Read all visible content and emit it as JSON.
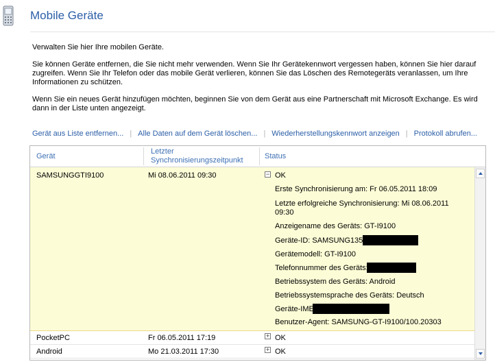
{
  "page": {
    "title": "Mobile Geräte"
  },
  "intro": {
    "line1": "Verwalten Sie hier Ihre mobilen Geräte.",
    "para2": "Sie können Geräte entfernen, die Sie nicht mehr verwenden. Wenn Sie Ihr Gerätekennwort vergessen haben, können Sie hier darauf zugreifen. Wenn Sie Ihr Telefon oder das mobile Gerät verlieren, können Sie das Löschen des Remotegeräts veranlassen, um Ihre Informationen zu schützen.",
    "para3": "Wenn Sie ein neues Gerät hinzufügen möchten, beginnen Sie von dem Gerät aus eine Partnerschaft mit Microsoft Exchange. Es wird dann in der Liste unten angezeigt."
  },
  "actions": [
    "Gerät aus Liste entfernen...",
    "Alle Daten auf dem Gerät löschen...",
    "Wiederherstellungskennwort anzeigen",
    "Protokoll abrufen..."
  ],
  "table": {
    "columns": [
      "Gerät",
      "Letzter Synchronisierungszeitpunkt",
      "Status"
    ],
    "rows": [
      {
        "device": "SAMSUNGGTI9100",
        "last_sync": "Mi 08.06.2011 09:30",
        "status": "OK",
        "toggle": "−"
      },
      {
        "device": "PocketPC",
        "last_sync": "Fr 06.05.2011 17:19",
        "status": "OK",
        "toggle": "+"
      },
      {
        "device": "Android",
        "last_sync": "Mo 21.03.2011 17:30",
        "status": "OK",
        "toggle": "+"
      }
    ],
    "details": [
      "Erste Synchronisierung am: Fr 06.05.2011 18:09",
      "Letzte erfolgreiche Synchronisierung: Mi 08.06.2011",
      "09:30",
      "Anzeigename des Geräts: GT-I9100",
      "Geräte-ID: SAMSUNG1355",
      "Gerätemodell: GT-I9100",
      "Telefonnummer des Geräts:",
      "Betriebssystem des Geräts: Android",
      "Betriebssystemsprache des Geräts: Deutsch",
      "Geräte-IMEI: 355",
      "Benutzer-Agent: SAMSUNG-GT-I9100/100.20303"
    ]
  },
  "colors": {
    "accent": "#2b5ea7",
    "selected_row": "#fcfcd7"
  },
  "icons": {
    "header": "mobile-phone-icon"
  }
}
